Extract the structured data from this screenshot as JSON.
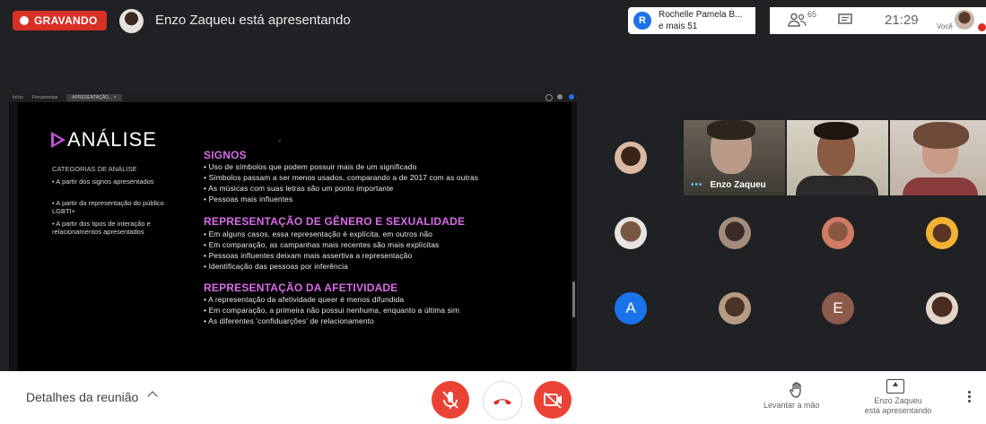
{
  "top_bar": {
    "recording_label": "GRAVANDO",
    "presenting_text": "Enzo Zaqueu está apresentando",
    "participants_chip": {
      "avatar_letter": "R",
      "name": "Rochelle Pamela B...",
      "more": "e mais 51"
    },
    "people_count": "65",
    "clock": "21:29",
    "you_label": "Você"
  },
  "slide_window": {
    "tabs": [
      "Início",
      "Ferramentas",
      "APRESENTAÇÃO..."
    ],
    "tab_close": "×"
  },
  "slide": {
    "title": "ANÁLISE",
    "categories_title": "CATEGORIAS DE ANÁLISE",
    "categories": [
      "A partir dos signos apresentados",
      "A partir da representação do público LGBTI+",
      "A partir dos tipos de interação e relacionamentos apresentados"
    ],
    "sections": [
      {
        "title": "SIGNOS",
        "lines": [
          "Uso de símbolos que podem possuir mais de um significado",
          "Símbolos passam a ser menos usados, comparando a de 2017 com as outras",
          "As músicas com suas letras são um ponto importante",
          "Pessoas mais influentes"
        ]
      },
      {
        "title": "REPRESENTAÇÃO DE GÊNERO E SEXUALIDADE",
        "lines": [
          "Em alguns casos, essa representação é explícita, em outros não",
          "Em comparação, as campanhas mais recentes são mais explícitas",
          "Pessoas influentes deixam mais assertiva a representação",
          "Identificação das pessoas por inferência"
        ]
      },
      {
        "title": "REPRESENTAÇÃO DA AFETIVIDADE",
        "lines": [
          "A representação da afetividade queer é menos difundida",
          "Em comparação, a primeira não possui nenhuma, enquanto a última sim",
          "As diferentes 'confiduarções' de relacionamento"
        ]
      }
    ]
  },
  "grid": {
    "speaker_name": "Enzo Zaqueu",
    "letter_tiles": [
      "A",
      "E"
    ]
  },
  "bottom_bar": {
    "details_label": "Detalhes da reunião",
    "raise_hand_label": "Levantar a mão",
    "presenter_label_1": "Enzo Zaqueu",
    "presenter_label_2": "está apresentando"
  },
  "colors": {
    "record_red": "#d93025",
    "meet_background": "#202124",
    "slide_heading": "#d96be8",
    "control_red": "#ea4335",
    "avatar_blue": "#1a73e8",
    "avatar_brown": "#8d5b4c"
  }
}
